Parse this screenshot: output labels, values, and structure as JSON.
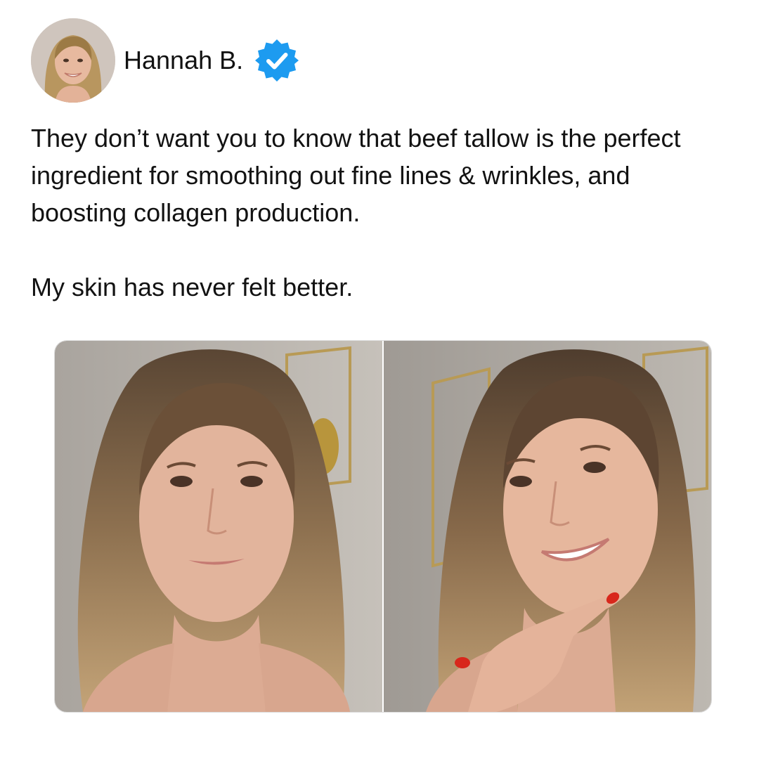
{
  "author": {
    "name": "Hannah B.",
    "verified": true,
    "avatar_icon": "profile-photo",
    "badge_icon": "verified-badge-icon",
    "badge_color": "#1d9bf0"
  },
  "post": {
    "paragraph_1": "They don’t want you to know that beef tallow is the perfect ingredient for smoothing out fine lines & wrinkles, and boosting collagen production.",
    "paragraph_2": "My skin has never felt better."
  },
  "media": {
    "images": [
      {
        "icon": "before-photo"
      },
      {
        "icon": "after-photo"
      }
    ]
  }
}
